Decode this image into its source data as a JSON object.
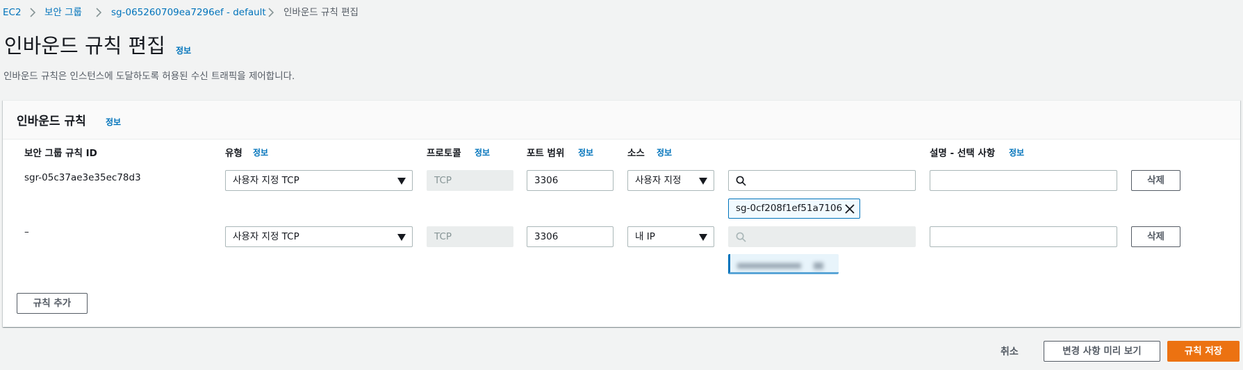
{
  "breadcrumb": {
    "items": [
      "EC2",
      "보안 그룹",
      "sg-065260709ea7296ef - default",
      "인바운드 규칙 편집"
    ]
  },
  "header": {
    "title": "인바운드 규칙 편집",
    "info": "정보",
    "description": "인바운드 규칙은 인스턴스에 도달하도록 허용된 수신 트래픽을 제어합니다."
  },
  "panel": {
    "title": "인바운드 규칙",
    "info": "정보",
    "columns": {
      "rule_id": "보안 그룹 규칙 ID",
      "type": "유형",
      "protocol": "프로토콜",
      "port_range": "포트 범위",
      "source": "소스",
      "description": "설명 - 선택 사항",
      "info": "정보"
    },
    "rows": [
      {
        "rule_id": "sgr-05c37ae3e35ec78d3",
        "type": "사용자 지정 TCP",
        "protocol": "TCP",
        "port_range": "3306",
        "source": "사용자 지정",
        "search_value": "",
        "token": "sg-0cf208f1ef51a7106",
        "description": "",
        "delete_label": "삭제"
      },
      {
        "rule_id": "–",
        "type": "사용자 지정 TCP",
        "protocol": "TCP",
        "port_range": "3306",
        "source": "내 IP",
        "search_value": "",
        "token": "",
        "description": "",
        "delete_label": "삭제"
      }
    ],
    "add_rule_label": "규칙 추가"
  },
  "footer": {
    "cancel_label": "취소",
    "preview_label": "변경 사항 미리 보기",
    "save_label": "규칙 저장"
  },
  "colors": {
    "link": "#0073bb",
    "primary": "#ec7211",
    "background": "#f2f3f3"
  },
  "icons": [
    "chevron-right-icon",
    "caret-down-icon",
    "search-icon",
    "close-icon"
  ]
}
